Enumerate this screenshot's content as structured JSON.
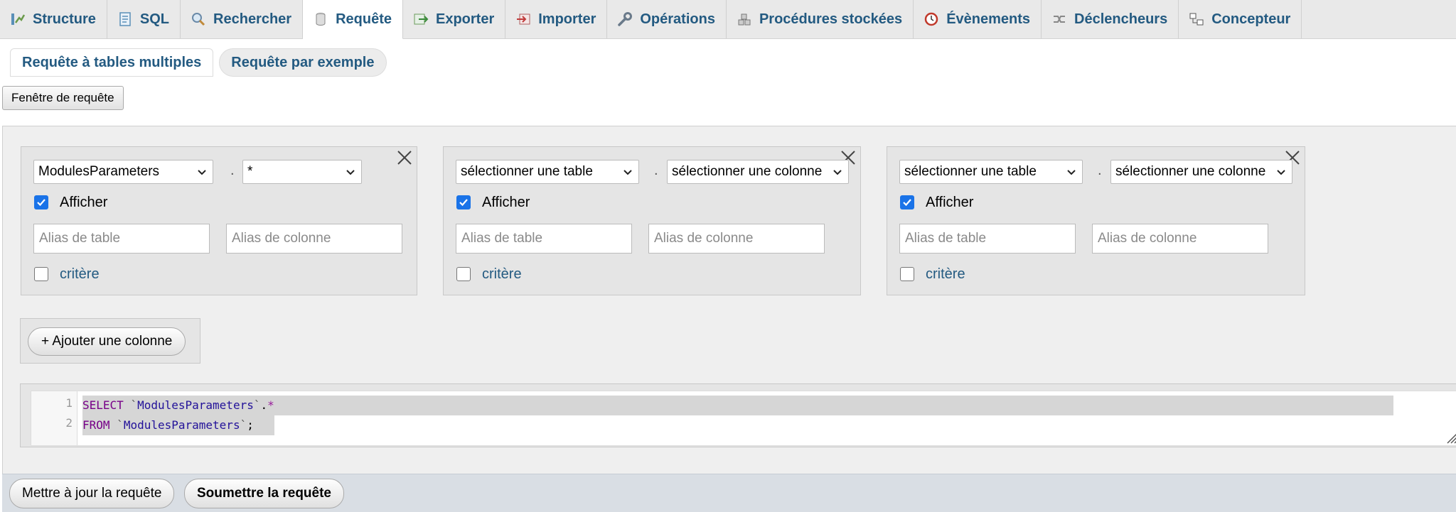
{
  "tabs": [
    {
      "label": "Structure",
      "icon": "structure-icon"
    },
    {
      "label": "SQL",
      "icon": "sql-icon"
    },
    {
      "label": "Rechercher",
      "icon": "search-icon"
    },
    {
      "label": "Requête",
      "icon": "database-icon",
      "active": true
    },
    {
      "label": "Exporter",
      "icon": "export-icon"
    },
    {
      "label": "Importer",
      "icon": "import-icon"
    },
    {
      "label": "Opérations",
      "icon": "wrench-icon"
    },
    {
      "label": "Procédures stockées",
      "icon": "routines-icon"
    },
    {
      "label": "Évènements",
      "icon": "clock-icon"
    },
    {
      "label": "Déclencheurs",
      "icon": "trigger-icon"
    },
    {
      "label": "Concepteur",
      "icon": "designer-icon"
    }
  ],
  "subtabs": {
    "multi": "Requête à tables multiples",
    "by_example": "Requête par exemple"
  },
  "query_window_button": "Fenêtre de requête",
  "columns": [
    {
      "table": "ModulesParameters",
      "column": "*",
      "show": true,
      "show_label": "Afficher",
      "table_alias_placeholder": "Alias de table",
      "column_alias_placeholder": "Alias de colonne",
      "criteria_label": "critère",
      "criteria": false
    },
    {
      "table": "sélectionner une table",
      "column": "sélectionner une colonne",
      "show": true,
      "show_label": "Afficher",
      "table_alias_placeholder": "Alias de table",
      "column_alias_placeholder": "Alias de colonne",
      "criteria_label": "critère",
      "criteria": false
    },
    {
      "table": "sélectionner une table",
      "column": "sélectionner une colonne",
      "show": true,
      "show_label": "Afficher",
      "table_alias_placeholder": "Alias de table",
      "column_alias_placeholder": "Alias de colonne",
      "criteria_label": "critère",
      "criteria": false
    }
  ],
  "column_separator": ".",
  "add_column_button": "+ Ajouter une colonne",
  "editor": {
    "line_numbers": [
      "1",
      "2"
    ],
    "line1": {
      "kw": "SELECT",
      "q1": "`",
      "ident": "ModulesParameters",
      "q2": "`",
      "dot": ".",
      "star": "*"
    },
    "line2": {
      "kw": "FROM",
      "q1": "`",
      "ident": "ModulesParameters",
      "q2": "`",
      "end": ";"
    }
  },
  "buttons": {
    "update": "Mettre à jour la requête",
    "submit": "Soumettre la requête"
  },
  "colors": {
    "link": "#235a81",
    "checkbox": "#1a73e8",
    "tab_bg": "#e9e9e9",
    "panel_bg": "#efefef",
    "bottom_bar": "#d9dee4"
  }
}
